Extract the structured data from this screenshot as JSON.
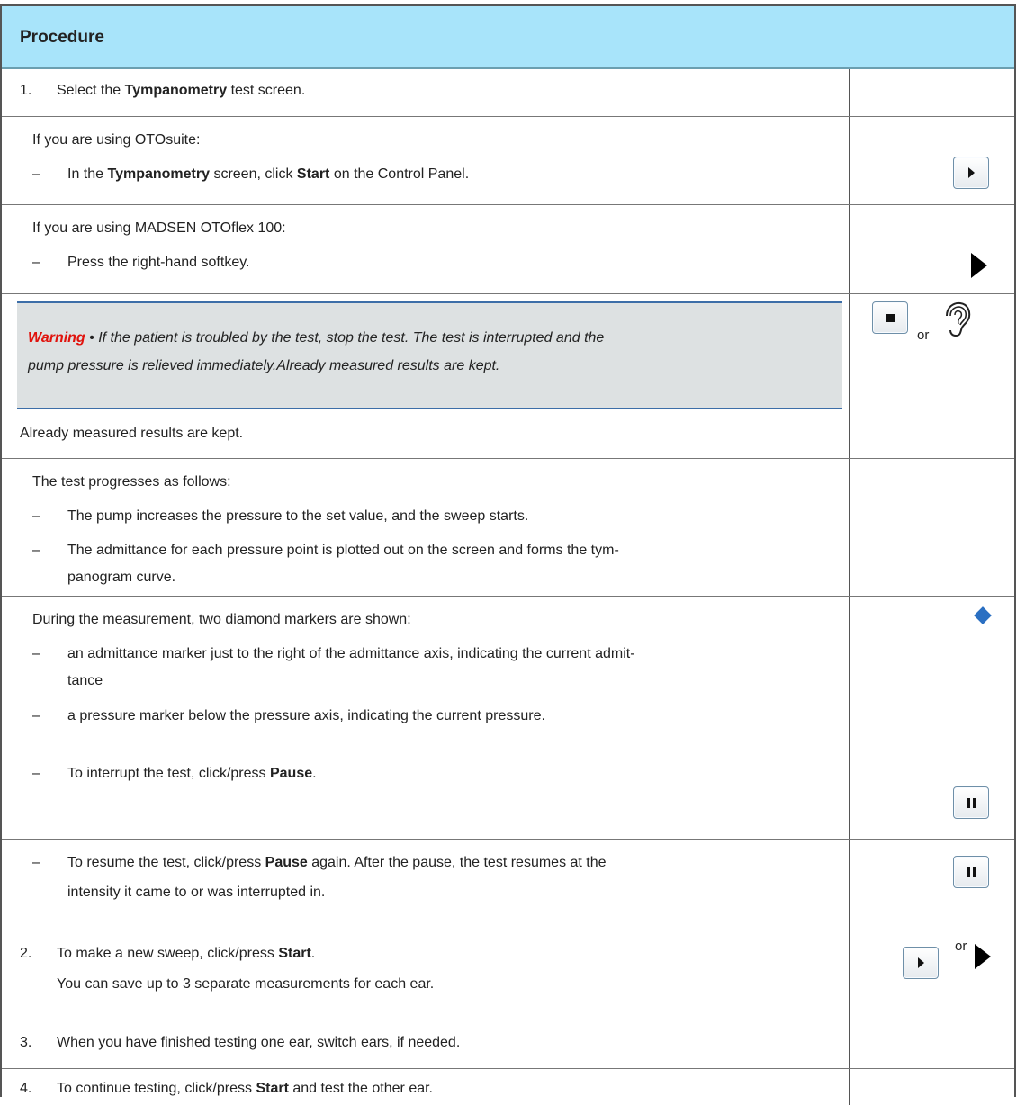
{
  "header": {
    "title": "Procedure"
  },
  "step1": {
    "num": "1.",
    "pre": "Select the ",
    "bold": "Tympanometry",
    "post": " test screen."
  },
  "otosuite": {
    "intro": "If you are using OTOsuite:",
    "dash": "–",
    "pre": "In the ",
    "bold1": "Tympanometry",
    "mid": " screen, click ",
    "bold2": "Start",
    "post": " on the Control Panel."
  },
  "otoflex": {
    "intro": "If you are using MADSEN OTOflex 100:",
    "dash": "–",
    "text": "Press the right-hand softkey."
  },
  "warning": {
    "label": "Warning",
    "line1": " • If the patient is troubled by the test, stop the test. The test is interrupted and the",
    "line2": "pump pressure is relieved immediately.Already measured results are kept.",
    "after": "Already measured results are kept.",
    "or": "or"
  },
  "progress": {
    "intro": "The test progresses as follows:",
    "items": [
      "The pump increases the pressure to the set value, and the sweep starts.",
      "The admittance for each pressure point is plotted out on the screen and forms the tym-",
      "panogram curve."
    ]
  },
  "markers": {
    "intro": "During the measurement, two diamond markers are shown:",
    "items": [
      "an admittance marker just to the right of the admittance axis, indicating the current admit-",
      "tance",
      "a pressure marker below the pressure axis, indicating the current pressure."
    ],
    "diamond_color": "#2a6fc2"
  },
  "pause1": {
    "pre": "To interrupt the test, click/press ",
    "bold": "Pause",
    "post": "."
  },
  "pause2": {
    "pre": "To resume the test, click/press ",
    "bold": "Pause",
    "post": " again. After the pause, the test resumes at the",
    "line2": "intensity it came to or was interrupted in."
  },
  "step2": {
    "num": "2.",
    "pre": "To make a new sweep, click/press ",
    "bold": "Start",
    "post": ".",
    "line2": "You can save up to 3 separate measurements for each ear.",
    "or": "or"
  },
  "step3": {
    "num": "3.",
    "text": "When you have finished testing one ear, switch ears, if needed."
  },
  "step4": {
    "num": "4.",
    "pre": "To continue testing, click/press ",
    "bold": "Start",
    "post": " and test the other ear."
  },
  "dash": "–",
  "colors": {
    "header_bg": "#a8e4fa",
    "warning_label": "#e0130d",
    "warning_rule": "#3c6ea8",
    "warning_bg": "#dde1e2"
  }
}
